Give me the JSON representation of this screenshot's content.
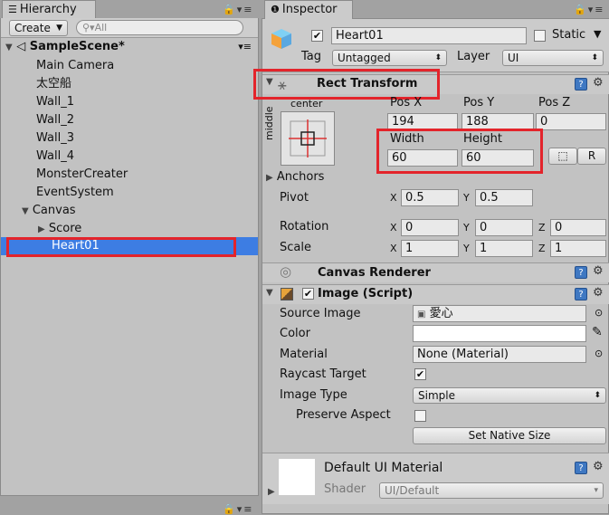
{
  "hierarchy": {
    "tab_title": "Hierarchy",
    "create_label": "Create",
    "search_placeholder": "All",
    "scene_name": "SampleScene*",
    "items": [
      "Main Camera",
      "太空船",
      "Wall_1",
      "Wall_2",
      "Wall_3",
      "Wall_4",
      "MonsterCreater",
      "EventSystem",
      "Canvas",
      "Score",
      "Heart01"
    ],
    "selected_item": "Heart01"
  },
  "inspector": {
    "tab_title": "Inspector",
    "object_name": "Heart01",
    "active_checked": true,
    "static_label": "Static",
    "static_checked": false,
    "tag_label": "Tag",
    "tag_value": "Untagged",
    "layer_label": "Layer",
    "layer_value": "UI",
    "rect_transform": {
      "title": "Rect Transform",
      "anchor_preset_top": "center",
      "anchor_preset_side": "middle",
      "pos_x_label": "Pos X",
      "pos_x": "194",
      "pos_y_label": "Pos Y",
      "pos_y": "188",
      "pos_z_label": "Pos Z",
      "pos_z": "0",
      "width_label": "Width",
      "width": "60",
      "height_label": "Height",
      "height": "60",
      "raw_button": "R",
      "anchors_label": "Anchors",
      "pivot_label": "Pivot",
      "pivot_x": "0.5",
      "pivot_y": "0.5",
      "rotation_label": "Rotation",
      "rot_x": "0",
      "rot_y": "0",
      "rot_z": "0",
      "scale_label": "Scale",
      "scale_x": "1",
      "scale_y": "1",
      "scale_z": "1",
      "x": "X",
      "y": "Y",
      "z": "Z"
    },
    "canvas_renderer": {
      "title": "Canvas Renderer"
    },
    "image": {
      "title": "Image (Script)",
      "enabled": true,
      "source_image_label": "Source Image",
      "source_image": "愛心",
      "color_label": "Color",
      "material_label": "Material",
      "material": "None (Material)",
      "raycast_label": "Raycast Target",
      "raycast_checked": true,
      "image_type_label": "Image Type",
      "image_type": "Simple",
      "preserve_label": "Preserve Aspect",
      "preserve_checked": false,
      "set_native_size": "Set Native Size"
    },
    "material_preview": {
      "name": "Default UI Material",
      "shader_label": "Shader",
      "shader_value": "UI/Default"
    }
  },
  "colors": {
    "highlight": "#e3242b",
    "selection": "#3d7de3"
  }
}
